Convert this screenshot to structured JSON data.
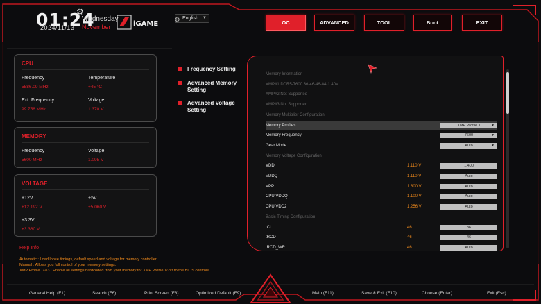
{
  "header": {
    "time": "01:24",
    "date": "2024/11/13",
    "weekday": "Wednesday",
    "month": "November",
    "logo_text": "iGAME",
    "language": "English"
  },
  "top_nav": {
    "buttons": [
      {
        "label": "OC",
        "active": true
      },
      {
        "label": "ADVANCED",
        "active": false
      },
      {
        "label": "TOOL",
        "active": false
      },
      {
        "label": "Boot",
        "active": false
      },
      {
        "label": "EXIT",
        "active": false
      }
    ]
  },
  "cpu": {
    "title": "CPU",
    "frequency_label": "Frequency",
    "frequency_value": "5586.09 MHz",
    "temperature_label": "Temperature",
    "temperature_value": "+45 °C",
    "ext_frequency_label": "Ext. Frequency",
    "ext_frequency_value": "99.758 MHz",
    "voltage_label": "Voltage",
    "voltage_value": "1.370 V"
  },
  "memory": {
    "title": "MEMORY",
    "frequency_label": "Frequency",
    "frequency_value": "5600 MHz",
    "voltage_label": "Voltage",
    "voltage_value": "1.095 V"
  },
  "voltage": {
    "title": "VOLTAGE",
    "v12_label": "+12V",
    "v12_value": "+12.192 V",
    "v5_label": "+5V",
    "v5_value": "+5.060 V",
    "v33_label": "+3.3V",
    "v33_value": "+3.360 V"
  },
  "help": {
    "title": "Help Info",
    "lines": [
      "Automatic : Load loose timings, default speed and voltage for memory controller.",
      "Manual : Allows you full control of your memory settings.",
      "XMP Profile 1/2/3 : Enable all settings hardcoded from your memory for XMP Profile 1/2/3 to the BIOS controls."
    ]
  },
  "side_menu": {
    "items": [
      "Frequency Setting",
      "Advanced Memory Setting",
      "Advanced Voltage Setting"
    ]
  },
  "settings": {
    "rows": [
      {
        "kind": "sect",
        "label": "Memory Information"
      },
      {
        "kind": "info",
        "label": "XMP#1 DDR5-7600 36-46-46-84-1.40V"
      },
      {
        "kind": "info",
        "label": "XMP#2 Not Supported"
      },
      {
        "kind": "info",
        "label": "XMP#3 Not Supported"
      },
      {
        "kind": "sect",
        "label": "Memory Multiplier Configuration"
      },
      {
        "kind": "opt",
        "label": "Memory Profiles",
        "value": "",
        "field": "XMP Profile 1",
        "dropdown": true,
        "highlight": true
      },
      {
        "kind": "opt",
        "label": "Memory Frequency",
        "value": "",
        "field": "7600",
        "dropdown": true
      },
      {
        "kind": "opt",
        "label": "Gear Mode",
        "value": "",
        "field": "Auto",
        "dropdown": true
      },
      {
        "kind": "sect",
        "label": "Memory Voltage Configuration"
      },
      {
        "kind": "opt",
        "label": "VDD",
        "value": "1.110 V",
        "field": "1.400",
        "dropdown": false
      },
      {
        "kind": "opt",
        "label": "VDDQ",
        "value": "1.110 V",
        "field": "Auto",
        "dropdown": false
      },
      {
        "kind": "opt",
        "label": "VPP",
        "value": "1.800 V",
        "field": "Auto",
        "dropdown": false
      },
      {
        "kind": "opt",
        "label": "CPU VDDQ",
        "value": "1.100 V",
        "field": "Auto",
        "dropdown": false
      },
      {
        "kind": "opt",
        "label": "CPU VDD2",
        "value": "1.256 V",
        "field": "Auto",
        "dropdown": false
      },
      {
        "kind": "sect",
        "label": "Basic Timing Configuration"
      },
      {
        "kind": "opt",
        "label": "tCL",
        "value": "46",
        "field": "36",
        "dropdown": false
      },
      {
        "kind": "opt",
        "label": "tRCD",
        "value": "46",
        "field": "46",
        "dropdown": false
      },
      {
        "kind": "opt",
        "label": "tRCD_WR",
        "value": "46",
        "field": "Auto",
        "dropdown": false
      }
    ]
  },
  "footer": {
    "items": [
      "General Help (F1)",
      "Search (F6)",
      "Print Screen (F8)",
      "Optimized Default (F9)",
      "Main (F11)",
      "Save & Exit (F10)",
      "Choose (Enter)",
      "Exit (Esc)"
    ]
  },
  "colors": {
    "accent": "#e0202a",
    "value_orange": "#f08a1c",
    "background": "#0c0c0e"
  }
}
